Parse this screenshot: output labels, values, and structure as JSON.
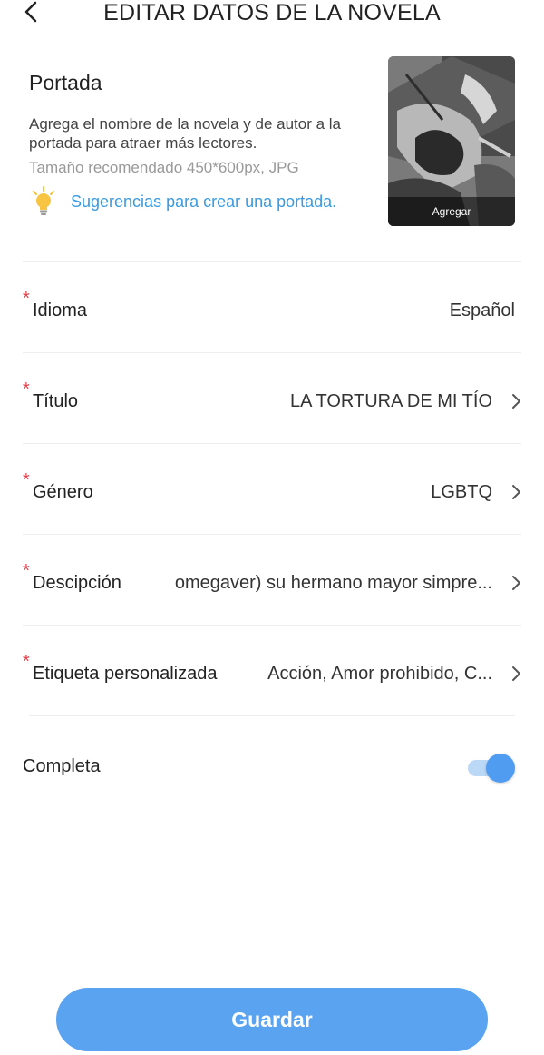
{
  "header": {
    "title": "EDITAR DATOS DE LA NOVELA",
    "back_icon": "chevron-left-icon"
  },
  "cover_section": {
    "title": "Portada",
    "description": "Agrega el nombre de la novela y de autor a la portada para atraer más lectores.",
    "recommended_size": "Tamaño recomendado 450*600px, JPG",
    "tip_icon": "lightbulb-icon",
    "tip_link": "Sugerencias para crear una portada.",
    "cover_button": "Agregar"
  },
  "fields": {
    "language": {
      "label": "Idioma",
      "value": "Español"
    },
    "title": {
      "label": "Título",
      "value": "LA TORTURA DE MI TÍO"
    },
    "genre": {
      "label": "Género",
      "value": "LGBTQ"
    },
    "description": {
      "label": "Descipción",
      "value": "omegaver) su hermano mayor simpre..."
    },
    "tags": {
      "label": "Etiqueta personalizada",
      "value": "Acción, Amor prohibido, C..."
    }
  },
  "complete": {
    "label": "Completa",
    "enabled": true
  },
  "save_button": "Guardar",
  "colors": {
    "accent": "#5aa3f0",
    "link": "#3a9ae0",
    "required": "#e2414a",
    "toggle_track": "#bcd8f7",
    "toggle_knob": "#4f9cf0"
  }
}
